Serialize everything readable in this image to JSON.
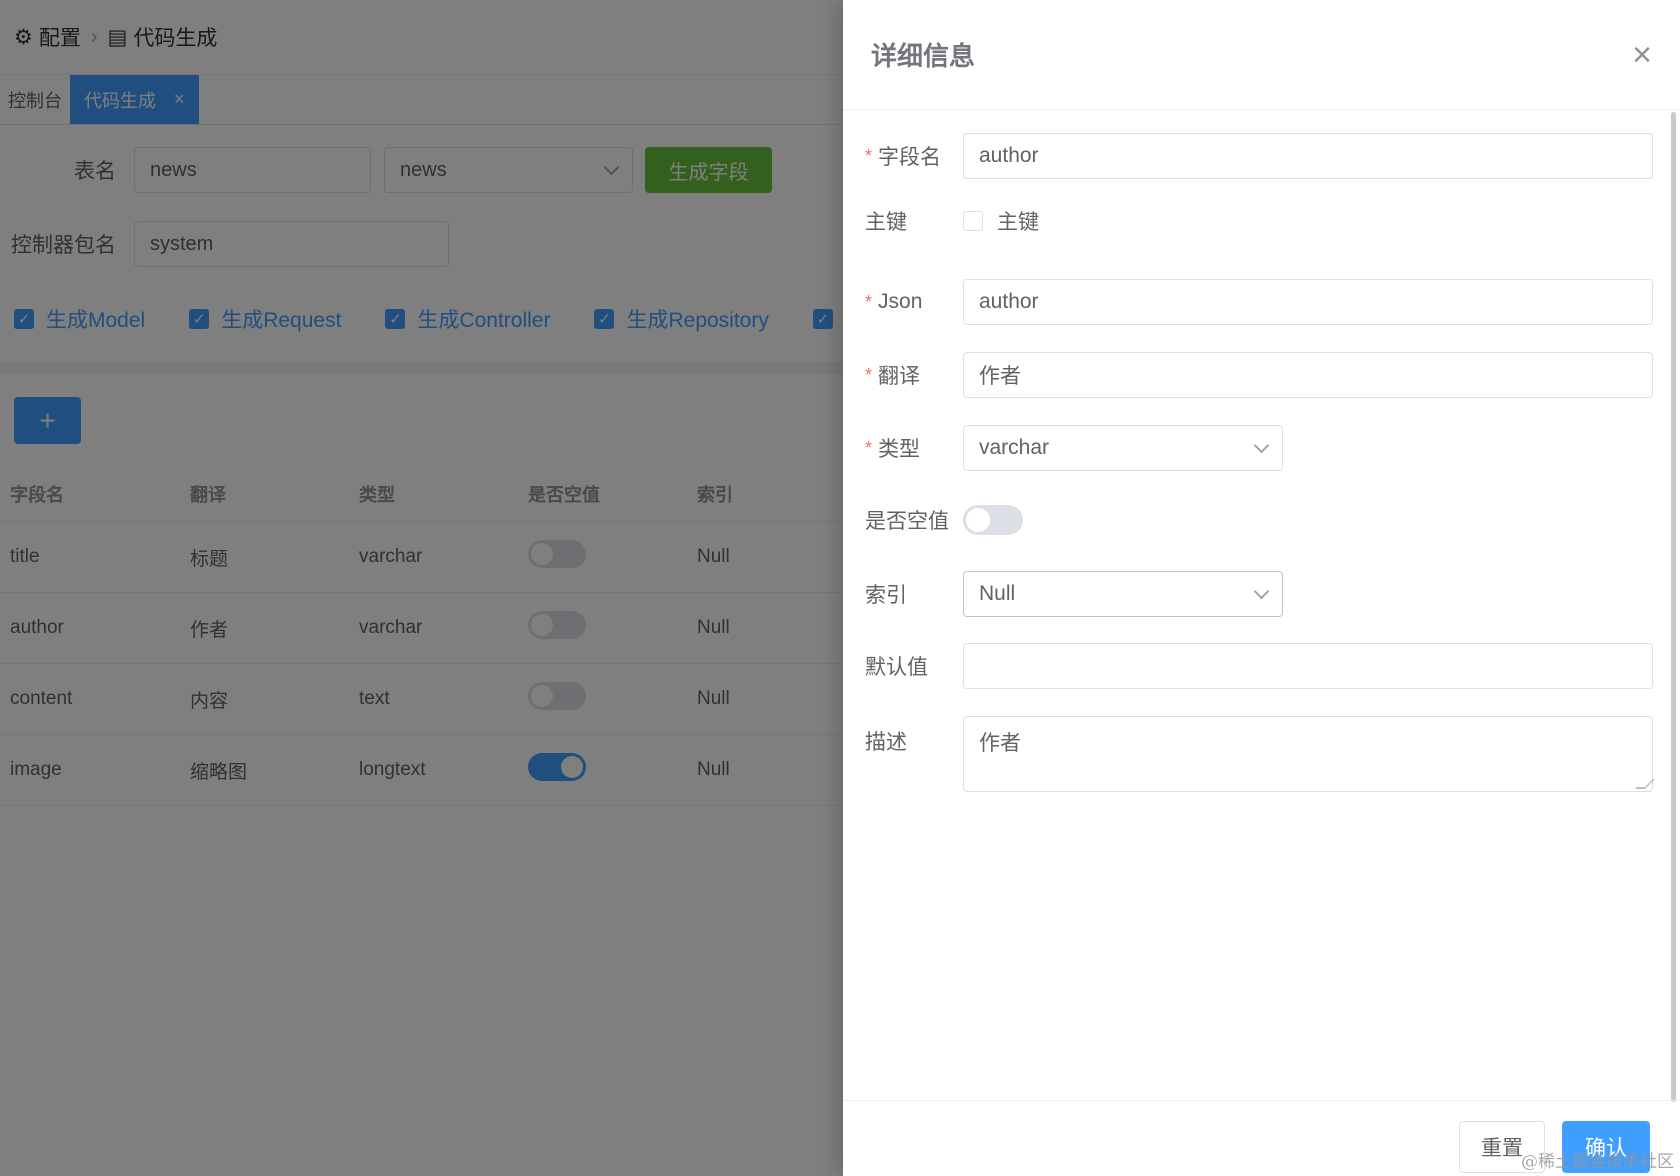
{
  "breadcrumb": {
    "item1": "配置",
    "item2": "代码生成"
  },
  "tabs": [
    {
      "label": "控制台"
    },
    {
      "label": "代码生成",
      "close": "×"
    }
  ],
  "form": {
    "table_label": "表名",
    "table_value": "news",
    "table_select_value": "news",
    "generate_fields_button": "生成字段",
    "controller_pkg_label": "控制器包名",
    "controller_pkg_value": "system"
  },
  "options": [
    {
      "label": "生成Model",
      "checked": true
    },
    {
      "label": "生成Request",
      "checked": true
    },
    {
      "label": "生成Controller",
      "checked": true
    },
    {
      "label": "生成Repository",
      "checked": true
    }
  ],
  "add_button": "+",
  "table": {
    "headers": [
      "字段名",
      "翻译",
      "类型",
      "是否空值",
      "索引"
    ],
    "rows": [
      {
        "name": "title",
        "translation": "标题",
        "type": "varchar",
        "nullable": false,
        "index": "Null"
      },
      {
        "name": "author",
        "translation": "作者",
        "type": "varchar",
        "nullable": false,
        "index": "Null"
      },
      {
        "name": "content",
        "translation": "内容",
        "type": "text",
        "nullable": false,
        "index": "Null"
      },
      {
        "name": "image",
        "translation": "缩略图",
        "type": "longtext",
        "nullable": true,
        "index": "Null"
      }
    ]
  },
  "drawer": {
    "title": "详细信息",
    "close": "×",
    "fields": {
      "field_name_label": "字段名",
      "field_name_value": "author",
      "primary_key_label": "主键",
      "primary_key_checkbox": "主键",
      "json_label": "Json",
      "json_value": "author",
      "translation_label": "翻译",
      "translation_value": "作者",
      "type_label": "类型",
      "type_value": "varchar",
      "nullable_label": "是否空值",
      "index_label": "索引",
      "index_value": "Null",
      "default_label": "默认值",
      "default_value": "",
      "desc_label": "描述",
      "desc_value": "作者"
    },
    "reset_button": "重置",
    "confirm_button": "确认"
  },
  "watermark": "@稀土掘金技术社区",
  "colors": {
    "primary": "#409eff",
    "success": "#67c23a",
    "danger": "#f56c6c",
    "mask": "rgba(0,0,0,0.5)"
  }
}
